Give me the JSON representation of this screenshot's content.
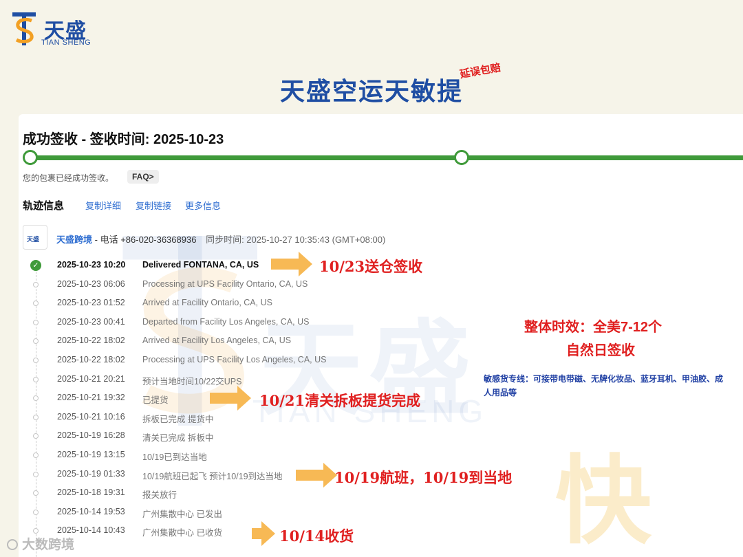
{
  "brand": {
    "name_cn": "天盛",
    "name_en": "TIAN SHENG"
  },
  "headline": "天盛空运天敏提",
  "sticker": "延误包赔",
  "status": {
    "title": "成功签收 - 签收时间: 2025-10-23",
    "note": "您的包裹已经成功签收。",
    "faq": "FAQ>",
    "progress": 1.0
  },
  "tracking": {
    "label": "轨迹信息",
    "links": [
      "复制详细",
      "复制链接",
      "更多信息"
    ],
    "carrier_icon_text": "天盛",
    "carrier_name": "天盛跨境",
    "carrier_phone": "- 电话 +86-020-36368936",
    "sync_time": "同步时间: 2025-10-27 10:35:43 (GMT+08:00)"
  },
  "events": [
    {
      "time": "2025-10-23 10:20",
      "desc": "Delivered FONTANA, CA, US"
    },
    {
      "time": "2025-10-23 06:06",
      "desc": "Processing at UPS Facility Ontario, CA, US"
    },
    {
      "time": "2025-10-23 01:52",
      "desc": "Arrived at Facility Ontario, CA, US"
    },
    {
      "time": "2025-10-23 00:41",
      "desc": "Departed from Facility Los Angeles, CA, US"
    },
    {
      "time": "2025-10-22 18:02",
      "desc": "Arrived at Facility Los Angeles, CA, US"
    },
    {
      "time": "2025-10-22 18:02",
      "desc": "Processing at UPS Facility Los Angeles, CA, US"
    },
    {
      "time": "2025-10-21 20:21",
      "desc": "预计当地时间10/22交UPS"
    },
    {
      "time": "2025-10-21 19:32",
      "desc": "已提货"
    },
    {
      "time": "2025-10-21 10:16",
      "desc": "拆板已完成 提货中"
    },
    {
      "time": "2025-10-19 16:28",
      "desc": "清关已完成 拆板中"
    },
    {
      "time": "2025-10-19 13:15",
      "desc": "10/19已到达当地"
    },
    {
      "time": "2025-10-19 01:33",
      "desc": "10/19航班已起飞 预计10/19到达当地"
    },
    {
      "time": "2025-10-18 19:31",
      "desc": "报关放行"
    },
    {
      "time": "2025-10-14 19:53",
      "desc": "广州集散中心 已发出"
    },
    {
      "time": "2025-10-14 10:43",
      "desc": "广州集散中心 已收货"
    }
  ],
  "callouts": [
    "10/23送仓签收",
    "10/21清关拆板提货完成",
    "10/19航班，10/19到当地",
    "10/14收货"
  ],
  "summary": {
    "line1": "整体时效：全美7-12个",
    "line2": "自然日签收",
    "sensitive": "敏感货专线：可接带电带磁、无牌化妆品、蓝牙耳机、甲油胶、成人用品等"
  },
  "watermarks": {
    "big": "天盛",
    "en": "TIAN SHENG",
    "fast": "快"
  },
  "footer_watermark": "大数跨境",
  "colors": {
    "brand_blue": "#1f4ea3",
    "progress_green": "#3f9a3a",
    "callout_red": "#e02020",
    "arrow_orange": "#f7b955",
    "link_blue": "#2f6ed1"
  }
}
